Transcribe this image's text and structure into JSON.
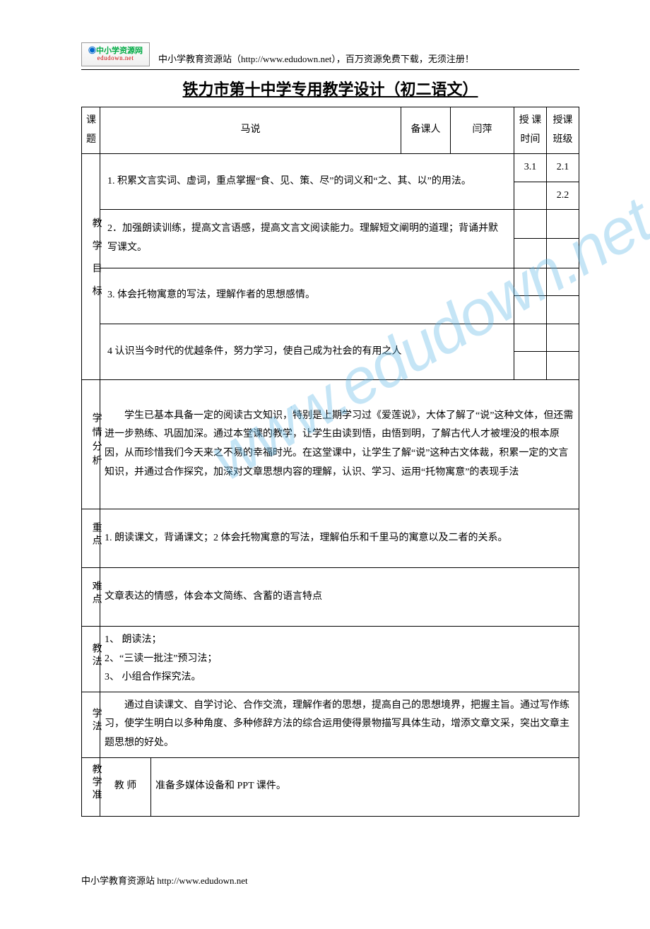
{
  "header": {
    "logo_top": "中小学资源网",
    "logo_bottom": "edudown.net",
    "text": "中小学教育资源站（http://www.edudown.net），百万资源免费下载，无须注册！"
  },
  "title": "铁力市第十中学专用教学设计（初二语文）",
  "row1": {
    "label_keti": "课题",
    "keti_value": "马说",
    "label_beikeren": "备课人",
    "beikeren_value": "闫萍",
    "label_shoukeshijian": "授 课时间",
    "label_shoukebanji": "授课班级"
  },
  "goals": {
    "label": "教学目标",
    "item1": "1. 积累文言实词、虚词，重点掌握“食、见、策、尽”的词义和“之、其、以”的用法。",
    "item2": "2．加强朗读训练，提高文言语感，提高文言文阅读能力。理解短文阐明的道理；背诵并默写课文。",
    "item3": "3. 体会托物寓意的写法，理解作者的思想感情。",
    "item4": "4 认识当今时代的优越条件，努力学习，使自己成为社会的有用之人"
  },
  "time_cells": {
    "t1": "3.1",
    "t2": "2.1",
    "t3": "",
    "t4": "2.2"
  },
  "xueqing": {
    "label": "学情分析",
    "text": "学生已基本具备一定的阅读古文知识，特别是上期学习过《爱莲说》，大体了解了“说”这种文体，但还需进一步熟练、巩固加深。通过本堂课的教学，让学生由读到悟，由悟到明，了解古代人才被埋没的根本原因，从而珍惜我们今天来之不易的幸福时光。在这堂课中，让学生了解“说”这种古文体裁，积累一定的文言知识，并通过合作探究，加深对文章思想内容的理解，认识、学习、运用“托物寓意”的表现手法"
  },
  "zhongdian": {
    "label": "重点",
    "text": "1. 朗读课文，背诵课文；2 体会托物寓意的写法，理解伯乐和千里马的寓意以及二者的关系。"
  },
  "nandian": {
    "label": "难点",
    "text": "文章表达的情感，体会本文简练、含蓄的语言特点"
  },
  "jiaofa": {
    "label": "教法",
    "l1": "1、 朗读法；",
    "l2": "2、“三读一批注”预习法；",
    "l3": "3、 小组合作探究法。"
  },
  "xuefa": {
    "label": "学法",
    "text": "通过自读课文、自学讨论、合作交流，理解作者的思想，提高自己的思想境界，把握主旨。通过写作练习，使学生明白以多种角度、多种修辞方法的综合运用使得景物描写具体生动，增添文章文采，突出文章主题思想的好处。"
  },
  "jiaoxuezhun": {
    "label": "教学准",
    "sub_label": "教 师",
    "text": "准备多媒体设备和 PPT 课件。"
  },
  "footer": "中小学教育资源站  http://www.edudown.net",
  "watermark": "www.edudown.net"
}
